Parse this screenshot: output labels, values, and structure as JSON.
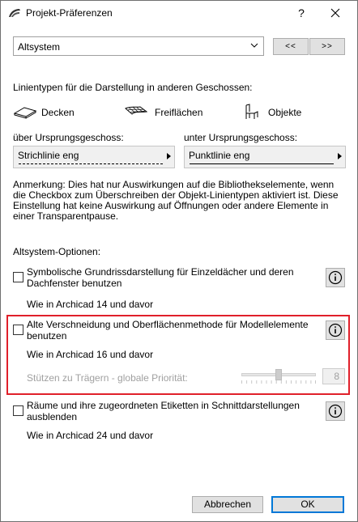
{
  "window": {
    "title": "Projekt-Präferenzen",
    "help_label": "?",
    "close_label": "✕"
  },
  "preset_select": {
    "value": "Altsystem"
  },
  "nav": {
    "prev_label": "<<",
    "next_label": ">>"
  },
  "linetypes": {
    "heading": "Linientypen für die Darstellung in anderen Geschossen:",
    "items": [
      {
        "label": "Decken",
        "icon": "slab-icon"
      },
      {
        "label": "Freiflächen",
        "icon": "mesh-icon"
      },
      {
        "label": "Objekte",
        "icon": "chair-icon"
      }
    ],
    "above_label": "über Ursprungsgeschoss:",
    "below_label": "unter Ursprungsgeschoss:",
    "above_value": "Strichlinie eng",
    "below_value": "Punktlinie eng"
  },
  "note": "Anmerkung: Dies hat nur Auswirkungen auf die Bibliothekselemente, wenn die Checkbox zum Überschreiben der Objekt-Linientypen aktiviert ist. Diese Einstellung hat keine Auswirkung auf Öffnungen oder andere Elemente in einer Transparentpause.",
  "options": {
    "heading": "Altsystem-Optionen:",
    "opt1": {
      "label": "Symbolische Grundrissdarstellung für Einzeldächer und deren Dachfenster benutzen",
      "sub": "Wie in Archicad 14 und davor",
      "checked": false
    },
    "opt2": {
      "label": "Alte Verschneidung und Oberflächenmethode für Modellelemente benutzen",
      "sub": "Wie in Archicad 16 und davor",
      "checked": false,
      "priority_label": "Stützen zu Trägern - globale Priorität:",
      "priority_value": "8",
      "priority_level": 0.5
    },
    "opt3": {
      "label": "Räume und ihre zugeordneten Etiketten in Schnittdarstellungen ausblenden",
      "sub": "Wie in Archicad 24 und davor",
      "checked": false
    }
  },
  "footer": {
    "cancel_label": "Abbrechen",
    "ok_label": "OK"
  },
  "colors": {
    "highlight": "#e0202a",
    "default_button_border": "#0078d7"
  }
}
